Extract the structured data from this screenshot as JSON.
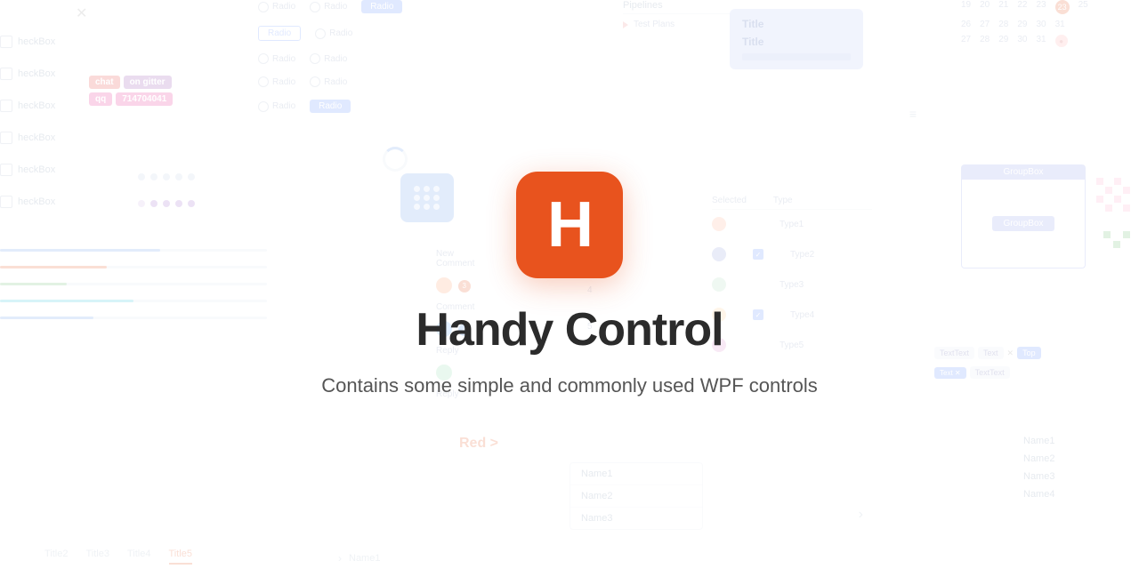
{
  "app": {
    "title": "Handy Control",
    "subtitle": "Contains some simple and commonly used WPF controls",
    "logo_letter": "H",
    "logo_bg": "#e8531e"
  },
  "background": {
    "checkboxes": [
      {
        "label": "heckBox",
        "checked": false
      },
      {
        "label": "heckBox",
        "checked": false
      },
      {
        "label": "heckBox",
        "checked": false
      },
      {
        "label": "heckBox",
        "checked": false
      },
      {
        "label": "heckBox",
        "checked": false
      },
      {
        "label": "heckBox",
        "checked": false
      }
    ],
    "badges": [
      {
        "text": "chat",
        "color": "chat"
      },
      {
        "text": "on gitter",
        "color": "gitter"
      },
      {
        "text": "qq",
        "color": "qq"
      },
      {
        "text": "714704041",
        "color": "num"
      }
    ],
    "radios": [
      {
        "label": "Radio",
        "active": false
      },
      {
        "label": "Radio",
        "active": true
      },
      {
        "label": "Radio",
        "active": false
      },
      {
        "label": "Radio",
        "active": false
      },
      {
        "label": "Radio",
        "active": false
      },
      {
        "label": "Radio",
        "active": true
      }
    ],
    "tabs": [
      {
        "label": "Title2",
        "active": false
      },
      {
        "label": "Title3",
        "active": false
      },
      {
        "label": "Title4",
        "active": false
      },
      {
        "label": "Title5",
        "active": true
      }
    ],
    "bottom_names": [
      "> Name1"
    ],
    "list_items": [
      "Name1",
      "Name2",
      "Name3"
    ],
    "list_right": [
      "Name1",
      "Name2",
      "Name3",
      "Name4"
    ],
    "type_rows": [
      "Type1",
      "Type2",
      "Type3",
      "Type4",
      "Type5"
    ],
    "red_arrow_text": "Red >",
    "calendar_rows": [
      [
        "19",
        "20",
        "21",
        "22",
        "23",
        "24",
        "25"
      ],
      [
        "26",
        "27",
        "28",
        "29",
        "30",
        "31"
      ],
      [
        "27",
        "28",
        "29",
        "30",
        "31"
      ]
    ]
  }
}
